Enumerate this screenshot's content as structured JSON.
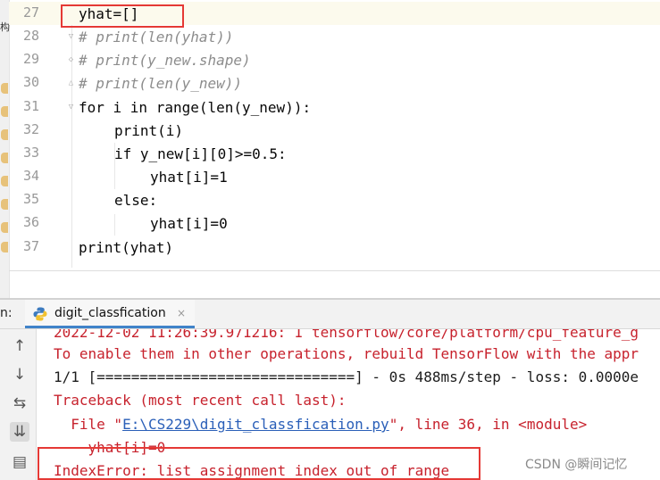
{
  "editor": {
    "left_strip_char": "构",
    "lines": [
      {
        "num": "27",
        "text": "yhat=[]"
      },
      {
        "num": "28",
        "text": "# print(len(yhat))"
      },
      {
        "num": "29",
        "text": "# print(y_new.shape)"
      },
      {
        "num": "30",
        "text": "# print(len(y_new))"
      },
      {
        "num": "31",
        "text": "for i in range(len(y_new)):"
      },
      {
        "num": "32",
        "text": "print(i)"
      },
      {
        "num": "33",
        "text": "if y_new[i][0]>=0.5:"
      },
      {
        "num": "34",
        "text": "yhat[i]=1"
      },
      {
        "num": "35",
        "text": "else:"
      },
      {
        "num": "36",
        "text": "yhat[i]=0"
      },
      {
        "num": "37",
        "text": "print(yhat)"
      }
    ]
  },
  "run_window": {
    "prefix": "n:",
    "tab_label": "digit_classfication",
    "tab_close": "×",
    "tools": [
      "up-arrow-icon",
      "down-arrow-icon",
      "soft-wrap-icon",
      "scroll-to-end-icon",
      "print-icon"
    ],
    "console": {
      "line1": "2022-12-02 11:26:39.971216: I tensorflow/core/platform/cpu_feature_g",
      "line2": "To enable them in other operations, rebuild TensorFlow with the appr",
      "line3": "1/1 [==============================] - 0s 488ms/step - loss: 0.0000e",
      "line4": "Traceback (most recent call last):",
      "line5_prefix": "  File \"",
      "line5_link": "E:\\CS229\\digit_classfication.py",
      "line5_suffix": "\", line 36, in <module>",
      "line6": "    yhat[i]=0",
      "line7": "IndexError: list assignment index out of range"
    }
  },
  "watermark": "CSDN @瞬间记忆",
  "colors": {
    "keyword": "#0033b3",
    "number": "#1750eb",
    "comment": "#8c8c8c",
    "error": "#c7222d",
    "highlight_box": "#e53935"
  }
}
